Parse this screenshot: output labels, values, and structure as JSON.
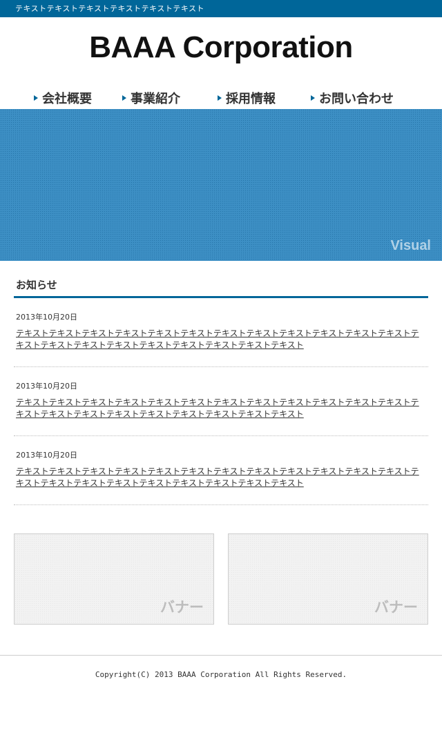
{
  "topbar": {
    "text": "テキストテキストテキストテキストテキストテキスト"
  },
  "header": {
    "logo": "BAAA Corporation",
    "nav": [
      {
        "label": "会社概要"
      },
      {
        "label": "事業紹介"
      },
      {
        "label": "採用情報"
      },
      {
        "label": "お問い合わせ"
      }
    ]
  },
  "visual": {
    "label": "Visual"
  },
  "news": {
    "title": "お知らせ",
    "items": [
      {
        "date": "2013年10月20日",
        "text": "テキストテキストテキストテキストテキストテキストテキストテキストテキストテキストテキストテキストテキストテキストテキストテキストテキストテキストテキストテキストテキスト"
      },
      {
        "date": "2013年10月20日",
        "text": "テキストテキストテキストテキストテキストテキストテキストテキストテキストテキストテキストテキストテキストテキストテキストテキストテキストテキストテキストテキストテキスト"
      },
      {
        "date": "2013年10月20日",
        "text": "テキストテキストテキストテキストテキストテキストテキストテキストテキストテキストテキストテキストテキストテキストテキストテキストテキストテキストテキストテキストテキスト"
      }
    ]
  },
  "banners": [
    {
      "label": "バナー"
    },
    {
      "label": "バナー"
    }
  ],
  "footer": {
    "copyright": "Copyright(C) 2013 BAAA Corporation All Rights Reserved."
  },
  "colors": {
    "brand": "#006699",
    "visual": "#3d8fc4"
  }
}
